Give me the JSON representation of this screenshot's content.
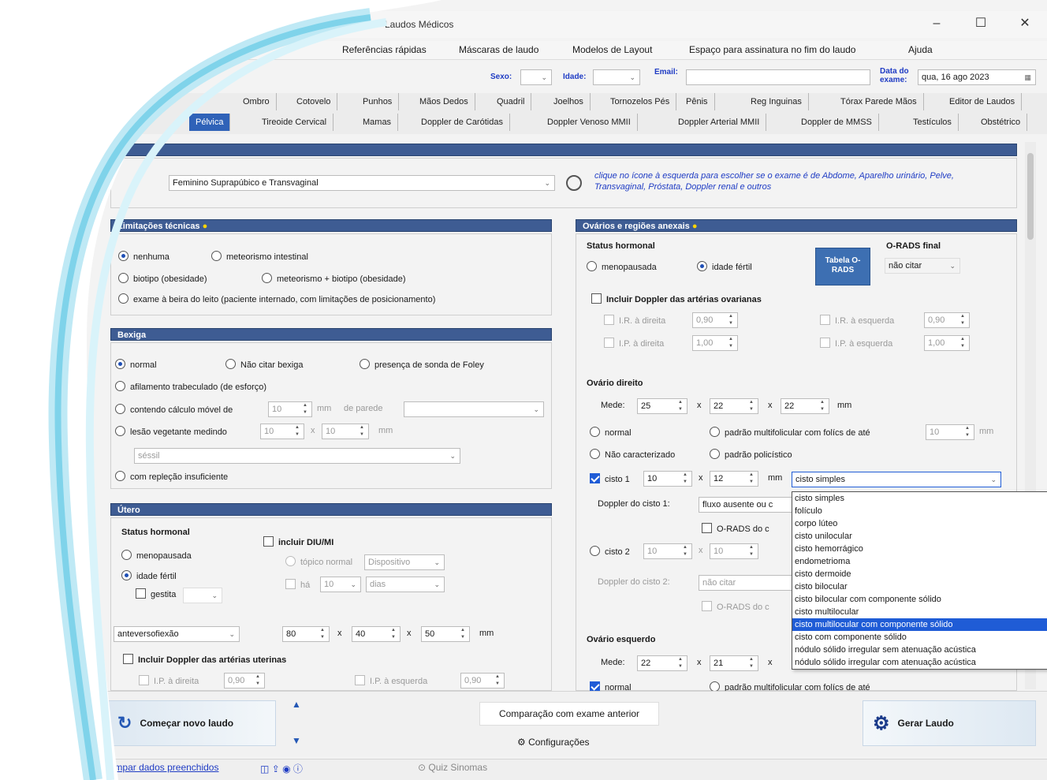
{
  "window": {
    "title": "Laudos Médicos",
    "controls": {
      "minimize": "–",
      "maximize": "☐",
      "close": "✕"
    }
  },
  "menu": [
    "Referências rápidas",
    "Máscaras de laudo",
    "Modelos de Layout",
    "Espaço para assinatura no fim do laudo",
    "Ajuda"
  ],
  "header": {
    "sexo_label": "Sexo:",
    "idade_label": "Idade:",
    "email_label": "Email:",
    "data_label": "Data do exame:",
    "data_value": "qua, 16 ago 2023"
  },
  "tabs_row1": [
    "Ombro",
    "Cotovelo",
    "Punhos",
    "Mãos Dedos",
    "Quadril",
    "Joelhos",
    "Tornozelos Pés",
    "Pênis",
    "Reg Inguinas",
    "Tórax Parede Mãos",
    "Editor de Laudos"
  ],
  "tabs_row2": [
    "Pélvica",
    "Tireoide Cervical",
    "Mamas",
    "Doppler de Carótidas",
    "Doppler Venoso MMII",
    "Doppler Arterial MMII",
    "Doppler de MMSS",
    "Testículos",
    "Obstétrico"
  ],
  "exam": {
    "value": "Feminino Suprapúbico e Transvaginal",
    "hint": "clique no ícone à esquerda para escolher se o exame é de Abdome, Aparelho urinário, Pelve, Transvaginal, Próstata, Doppler renal e outros"
  },
  "limitacoes": {
    "title": "Limitações técnicas",
    "options": [
      "nenhuma",
      "meteorismo intestinal",
      "biotipo (obesidade)",
      "meteorismo + biotipo (obesidade)",
      "exame à beira do leito (paciente internado, com limitações de posicionamento)"
    ]
  },
  "bexiga": {
    "title": "Bexiga",
    "options": [
      "normal",
      "Não citar bexiga",
      "presença de sonda de Foley",
      "afilamento trabeculado (de esforço)",
      "contendo cálculo móvel de",
      "lesão vegetante medindo",
      "com repleção insuficiente"
    ],
    "calc_value": "10",
    "calc_unit": "mm",
    "calc_extra": "de parede",
    "lesao_v1": "10",
    "lesao_v2": "10",
    "lesao_unit": "mm",
    "lesao_combo": "séssil"
  },
  "utero": {
    "title": "Útero",
    "status_label": "Status hormonal",
    "options": [
      "menopausada",
      "idade fértil",
      "gestita"
    ],
    "diu_label": "incluir DIU/MI",
    "diu_opt1": "tópico normal",
    "diu_combo": "Dispositivo",
    "diu_opt2": "há",
    "diu_value": "10",
    "diu_combo2": "dias",
    "position_combo": "anteversofiexão",
    "dims": [
      "80",
      "40",
      "50"
    ],
    "unit": "mm",
    "doppler_label": "Incluir Doppler das artérias uterinas",
    "ip_left_label": "I.P. à direita",
    "ip_left_val": "0,90",
    "ip_right_label": "I.P. à esquerda",
    "ip_right_val": "0,90"
  },
  "ovarios": {
    "title": "Ovários e regiões anexais",
    "status_label": "Status hormonal",
    "status_options": [
      "menopausada",
      "idade fértil"
    ],
    "orads_button": "Tabela O-RADS",
    "orads_label": "O-RADS final",
    "orads_value": "não citar",
    "doppler_label": "Incluir Doppler das artérias ovarianas",
    "ir_d_label": "I.R. à direita",
    "ir_d_val": "0,90",
    "ip_d_label": "I.P. à direita",
    "ip_d_val": "1,00",
    "ir_e_label": "I.R. à esquerda",
    "ir_e_val": "0,90",
    "ip_e_label": "I.P. à esquerda",
    "ip_e_val": "1,00",
    "direito_title": "Ovário direito",
    "mede_label": "Mede:",
    "direito_dims": [
      "25",
      "22",
      "22"
    ],
    "unit": "mm",
    "direito_opts": [
      "normal",
      "padrão multifolicular com folícs de até",
      "Não caracterizado",
      "padrão policístico"
    ],
    "folic_val": "10",
    "folic_unit": "mm",
    "cisto1_label": "cisto 1",
    "cisto1_dims": [
      "10",
      "12"
    ],
    "cisto1_combo": "cisto simples",
    "doppler_cisto1": "Doppler do cisto 1:",
    "doppler_cisto1_val": "fluxo ausente ou c",
    "orads_cisto": "O-RADS do c",
    "cisto2_label": "cisto 2",
    "cisto2_dims": [
      "10",
      "10"
    ],
    "doppler_cisto2": "Doppler do cisto 2:",
    "doppler_cisto2_val": "não citar",
    "orads_cisto2": "O-RADS do c",
    "esquerdo_title": "Ovário esquerdo",
    "esquerdo_dims": [
      "22",
      "21"
    ],
    "esquerdo_normal": "normal",
    "esquerdo_opt": "padrão multifolicular com folícs de até"
  },
  "dropdown": {
    "items": [
      "cisto simples",
      "folículo",
      "corpo lúteo",
      "cisto unilocular",
      "cisto hemorrágico",
      "endometrioma",
      "cisto dermoide",
      "cisto bilocular",
      "cisto bilocular com componente sólido",
      "cisto multilocular",
      "cisto multilocular com componente sólido",
      "cisto com componente sólido",
      "nódulo sólido irregular sem atenuação acústica",
      "nódulo sólido irregular com atenuação acústica"
    ],
    "highlighted_index": 10
  },
  "bottom": {
    "new_report": "Começar novo laudo",
    "compare": "Comparação com exame anterior",
    "config": "Configurações",
    "generate": "Gerar Laudo"
  },
  "status": {
    "clear": "Limpar dados preenchidos",
    "quiz": "Quiz Sinomas"
  },
  "colors": {
    "panel_header": "#3e5c93",
    "accent": "#1f5cd6",
    "hint_text": "#1f3cc4",
    "wave": "#7fd3ea"
  }
}
